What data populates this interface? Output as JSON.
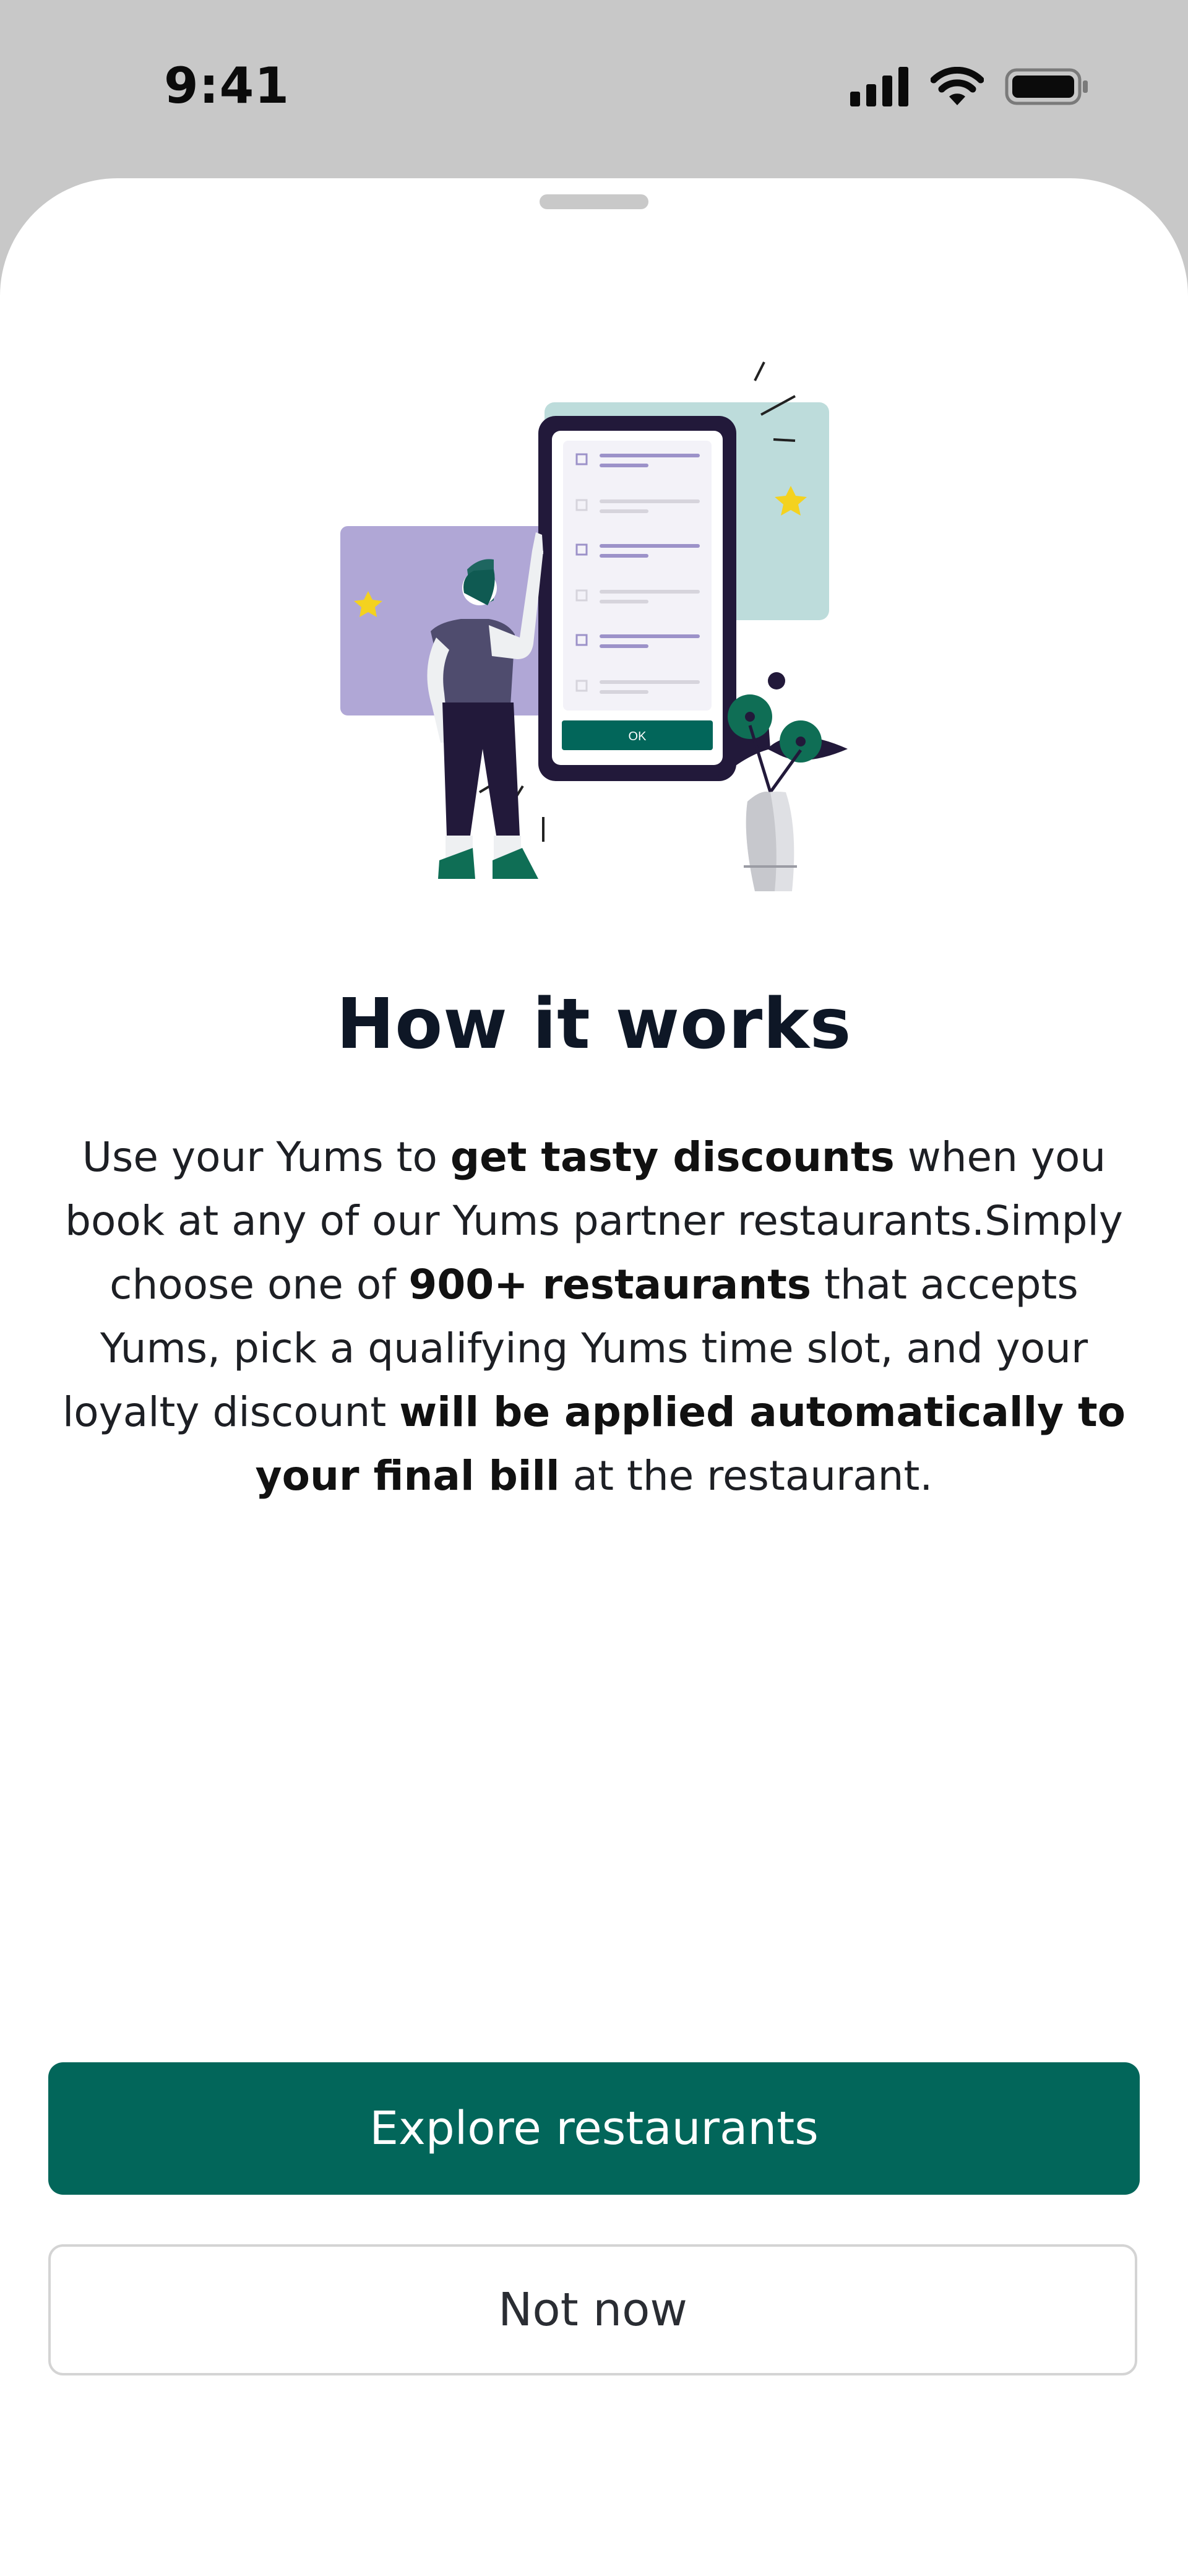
{
  "status_bar": {
    "time": "9:41",
    "icons": [
      "cellular-signal-icon",
      "wifi-icon",
      "battery-icon"
    ]
  },
  "illustration": {
    "phone_button_label": "OK",
    "icon": "person-with-phone-illustration"
  },
  "title": "How it works",
  "description": {
    "parts": [
      {
        "text": "Use your Yums to ",
        "bold": false
      },
      {
        "text": "get tasty discounts",
        "bold": true
      },
      {
        "text": " when you book at any of our Yums partner restaurants.Simply choose one of ",
        "bold": false
      },
      {
        "text": "900+ restaurants",
        "bold": true
      },
      {
        "text": " that accepts Yums, pick a qualifying Yums time slot, and your loyalty discount ",
        "bold": false
      },
      {
        "text": "will be applied automatically to your final bill",
        "bold": true
      },
      {
        "text": " at the restaurant.",
        "bold": false
      }
    ]
  },
  "buttons": {
    "primary": "Explore restaurants",
    "secondary": "Not now"
  },
  "colors": {
    "primary": "#02665a",
    "sheet": "#ffffff",
    "backdrop": "#c8c8c8"
  }
}
